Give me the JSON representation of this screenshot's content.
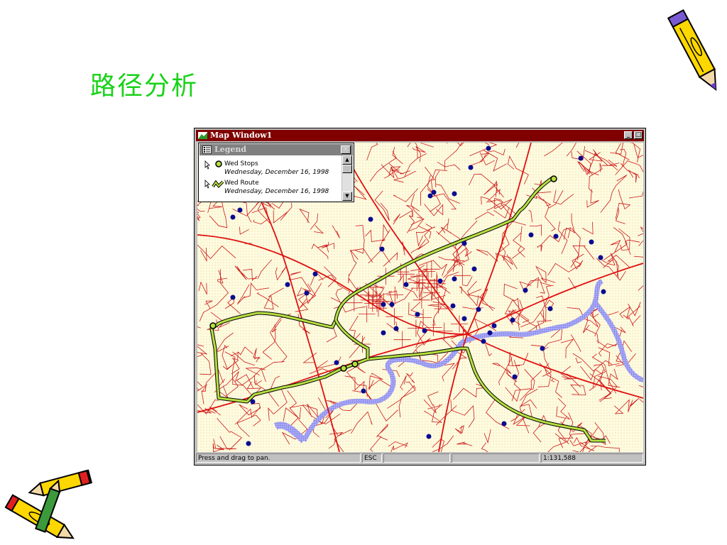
{
  "slide": {
    "title": "路径分析"
  },
  "map_window": {
    "title": "Map Window1",
    "minimize_label": "_",
    "maximize_label": "□"
  },
  "legend": {
    "title": "Legend",
    "close_label": "×",
    "items": [
      {
        "name": "Wed Stops",
        "date": "Wednesday, December 16, 1998",
        "symbol": "stop-point-icon"
      },
      {
        "name": "Wed Route",
        "date": "Wednesday, December 16, 1998",
        "symbol": "route-line-icon"
      }
    ]
  },
  "statusbar": {
    "message": "Press and drag to pan.",
    "key": "ESC",
    "field3": "",
    "field4": "",
    "scale": "1:131,588"
  },
  "colors": {
    "title_green": "#19d219",
    "titlebar": "#800000",
    "roads": "#cc0000",
    "river": "#6a6ae0",
    "route": "#9acd32",
    "stops": "#0a0a90",
    "map_bg": "#fefbe1"
  }
}
